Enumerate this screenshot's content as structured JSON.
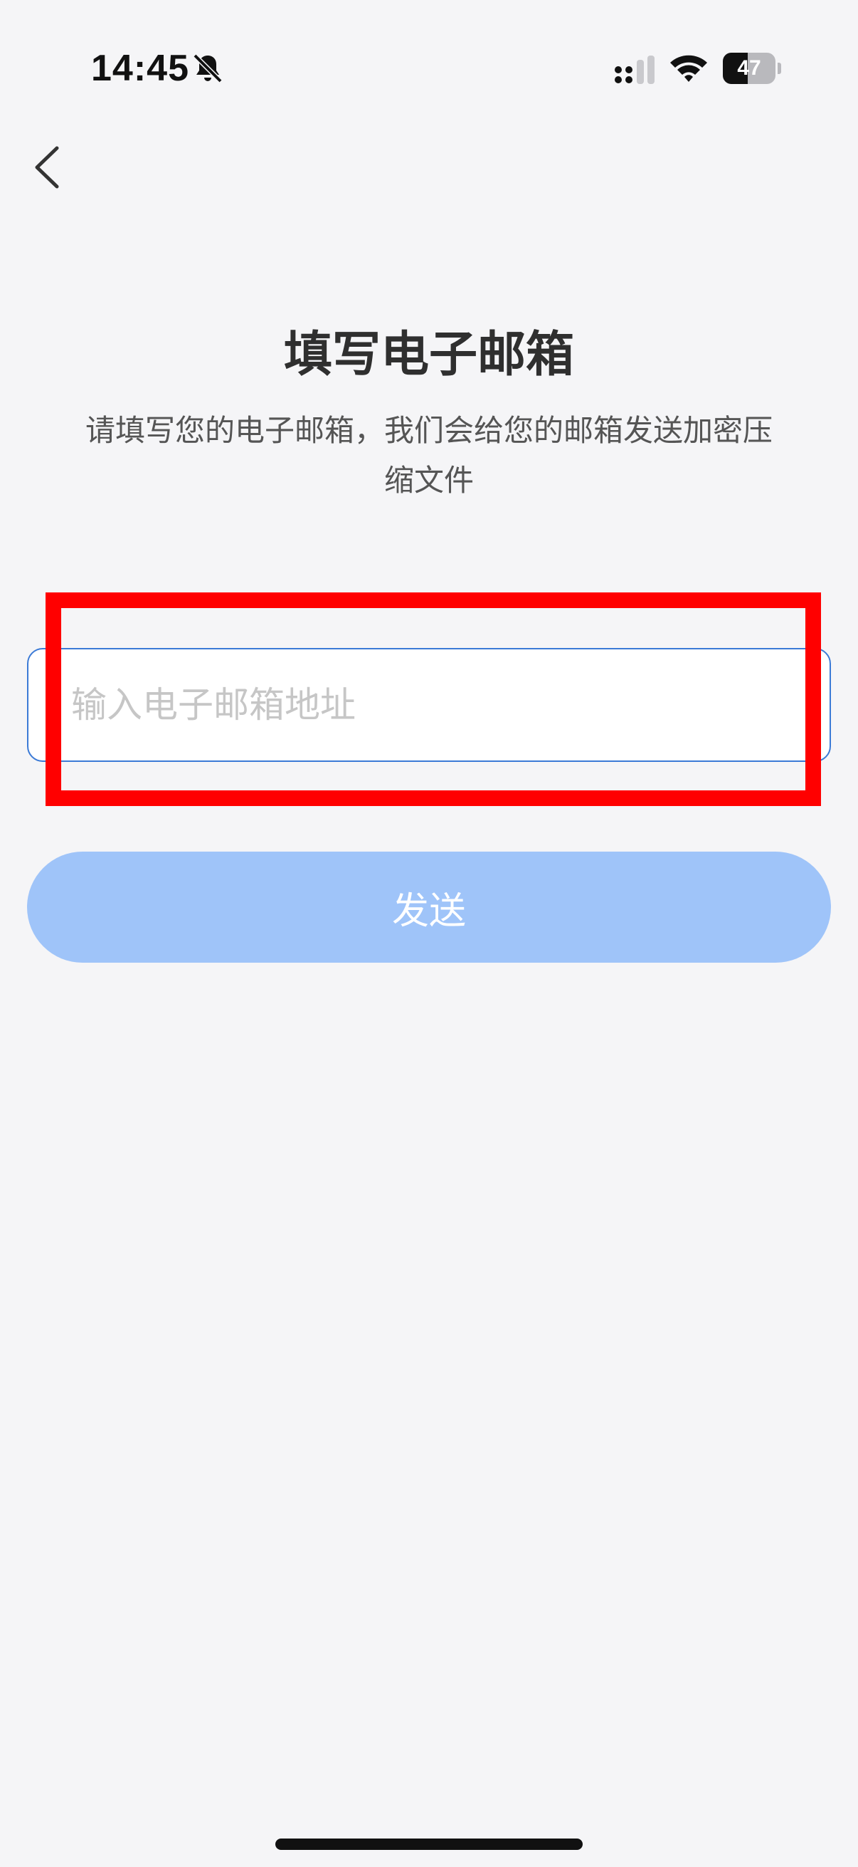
{
  "status_bar": {
    "time": "14:45",
    "battery_level": "47",
    "battery_fraction": 0.47,
    "icons": [
      "mute-bell-icon",
      "cellular-signal-icon",
      "wifi-icon",
      "battery-icon"
    ]
  },
  "nav": {
    "back_icon": "chevron-left-icon"
  },
  "page": {
    "title": "填写电子邮箱",
    "subtitle": "请填写您的电子邮箱，我们会给您的邮箱发送加密压缩文件"
  },
  "form": {
    "email_placeholder": "输入电子邮箱地址",
    "email_value": "",
    "send_label": "发送"
  },
  "colors": {
    "background": "#f5f5f7",
    "input_border": "#3b7ad6",
    "button_disabled": "#9fc4f9",
    "highlight": "#ff0000"
  }
}
